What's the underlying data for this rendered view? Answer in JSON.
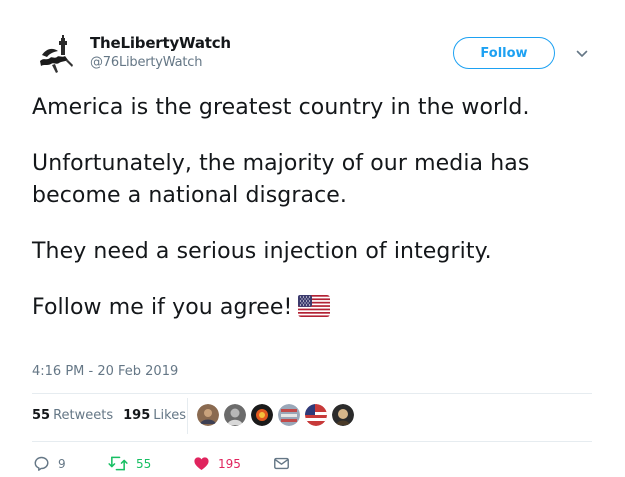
{
  "user": {
    "display_name": "TheLibertyWatch",
    "handle": "@76LibertyWatch",
    "avatar_icon": "pen-silhouette-avatar"
  },
  "follow_button": {
    "label": "Follow"
  },
  "tweet": {
    "paragraphs": [
      "America is the greatest country in the world.",
      "Unfortunately, the majority of our media has become a national disgrace.",
      "They need a serious injection of integrity.",
      "Follow me if you agree!"
    ],
    "emoji": "us-flag",
    "timestamp": "4:16 PM - 20 Feb 2019"
  },
  "stats": {
    "retweets_count": "55",
    "retweets_label": "Retweets",
    "likes_count": "195",
    "likes_label": "Likes"
  },
  "actions": {
    "reply_count": "9",
    "retweet_count": "55",
    "like_count": "195"
  },
  "colors": {
    "accent": "#1da1f2",
    "retweet_green": "#17bf63",
    "like_red": "#e0245e",
    "secondary_text": "#657786"
  }
}
